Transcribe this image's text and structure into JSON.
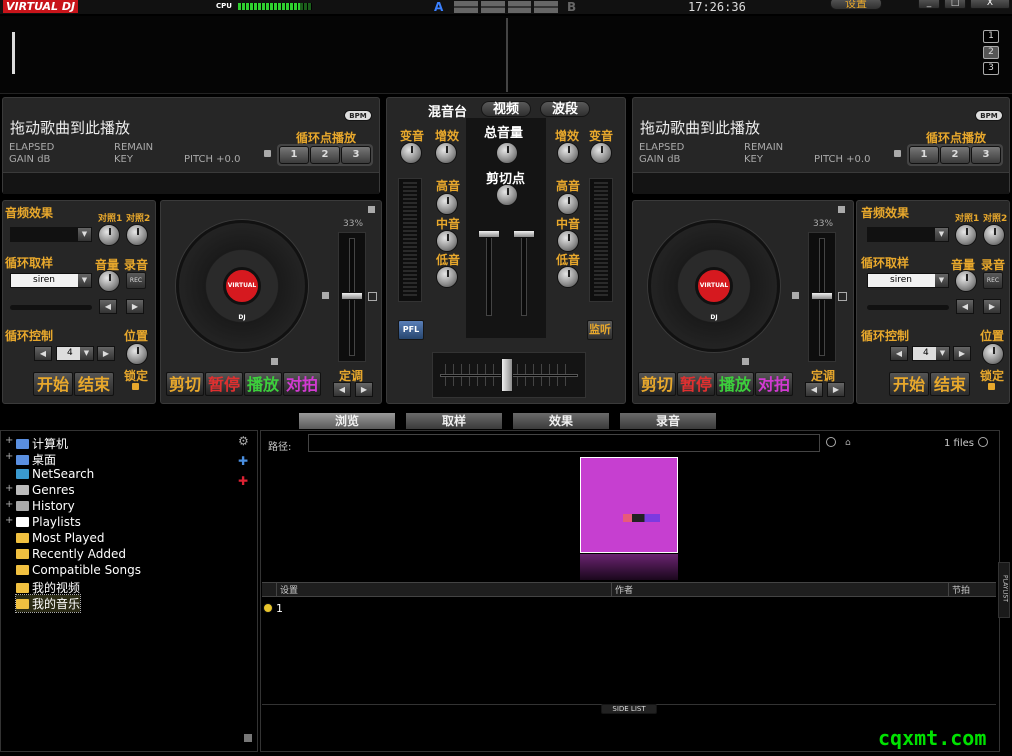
{
  "top": {
    "logo": "VIRTUAL DJ",
    "cpu_label": "CPU",
    "deck_a": "A",
    "deck_b": "B",
    "clock": "17:26:36",
    "settings": "设置",
    "win_min": "_",
    "win_max": "□",
    "win_close": "X",
    "layout_buttons": [
      "1",
      "2",
      "3"
    ]
  },
  "left_deck": {
    "title": "拖动歌曲到此播放",
    "bpm": "BPM",
    "elapsed": "ELAPSED",
    "remain": "REMAIN",
    "gain": "GAIN dB",
    "key": "KEY",
    "pitch": "PITCH +0.0",
    "loop_hot_label": "循环点播放",
    "hotcues": [
      "1",
      "2",
      "3"
    ],
    "fx_label": "音频效果",
    "param1": "对照1",
    "param2": "对照2",
    "sampler_label": "循环取样",
    "volume": "音量",
    "rec_label": "录音",
    "rec_btn": "REC",
    "sample": "siren",
    "loop_label": "循环控制",
    "position": "位置",
    "loop_value": "4",
    "lock": "锁定",
    "start": "开始",
    "end": "结束",
    "pitch_pct": "33%",
    "cut": "剪切",
    "pause": "暂停",
    "play": "播放",
    "sync": "对拍",
    "tune": "定调",
    "vinyl": "VIRTUAL DJ"
  },
  "right_deck": {
    "title": "拖动歌曲到此播放",
    "bpm": "BPM",
    "elapsed": "ELAPSED",
    "remain": "REMAIN",
    "gain": "GAIN dB",
    "key": "KEY",
    "pitch": "PITCH +0.0",
    "loop_hot_label": "循环点播放",
    "hotcues": [
      "1",
      "2",
      "3"
    ],
    "fx_label": "音频效果",
    "param1": "对照1",
    "param2": "对照2",
    "sampler_label": "循环取样",
    "volume": "音量",
    "rec_label": "录音",
    "rec_btn": "REC",
    "sample": "siren",
    "loop_label": "循环控制",
    "position": "位置",
    "loop_value": "4",
    "lock": "锁定",
    "start": "开始",
    "end": "结束",
    "pitch_pct": "33%",
    "cut": "剪切",
    "pause": "暂停",
    "play": "播放",
    "sync": "对拍",
    "tune": "定调",
    "vinyl": "VIRTUAL DJ"
  },
  "mixer": {
    "tab_mixer": "混音台",
    "tab_video": "视频",
    "tab_scratch": "波段",
    "gain_l": "变音",
    "boost_l": "增效",
    "master": "总音量",
    "boost_r": "增效",
    "gain_r": "变音",
    "high_l": "高音",
    "mid_l": "中音",
    "low_l": "低音",
    "high_r": "高音",
    "mid_r": "中音",
    "low_r": "低音",
    "cue": "剪切点",
    "pfl": "PFL",
    "monitor": "监听"
  },
  "browser_tabs": [
    "浏览",
    "取样",
    "效果",
    "录音"
  ],
  "tree": [
    {
      "label": "计算机",
      "icon": "computer-icon",
      "plus": true
    },
    {
      "label": "桌面",
      "icon": "desktop-icon",
      "plus": true
    },
    {
      "label": "NetSearch",
      "icon": "netsearch-icon",
      "plus": false
    },
    {
      "label": "Genres",
      "icon": "genres-icon",
      "plus": true
    },
    {
      "label": "History",
      "icon": "history-icon",
      "plus": true
    },
    {
      "label": "Playlists",
      "icon": "playlists-icon",
      "plus": true
    },
    {
      "label": "Most Played",
      "icon": "folder-icon",
      "plus": false
    },
    {
      "label": "Recently Added",
      "icon": "folder-icon",
      "plus": false
    },
    {
      "label": "Compatible Songs",
      "icon": "folder-icon",
      "plus": false
    },
    {
      "label": "我的视频",
      "icon": "folder-icon",
      "plus": false
    },
    {
      "label": "我的音乐",
      "icon": "folder-icon",
      "plus": false
    }
  ],
  "browser": {
    "path_label": "路径:",
    "path_value": "",
    "files_count": "1 files",
    "columns": [
      "设置",
      "作者",
      "节拍"
    ],
    "row_value": "1",
    "side_list": "SIDE LIST",
    "playlist_tab": "PLAYLIST"
  },
  "watermark": "cqxmt.com",
  "colors": {
    "accent_orange": "#e8a82c",
    "cut": "#e8a82c",
    "pause": "#e03030",
    "play": "#3ccf3c",
    "sync": "#d23ad2",
    "cover": "#c63fd0",
    "watermark": "#00e000"
  }
}
